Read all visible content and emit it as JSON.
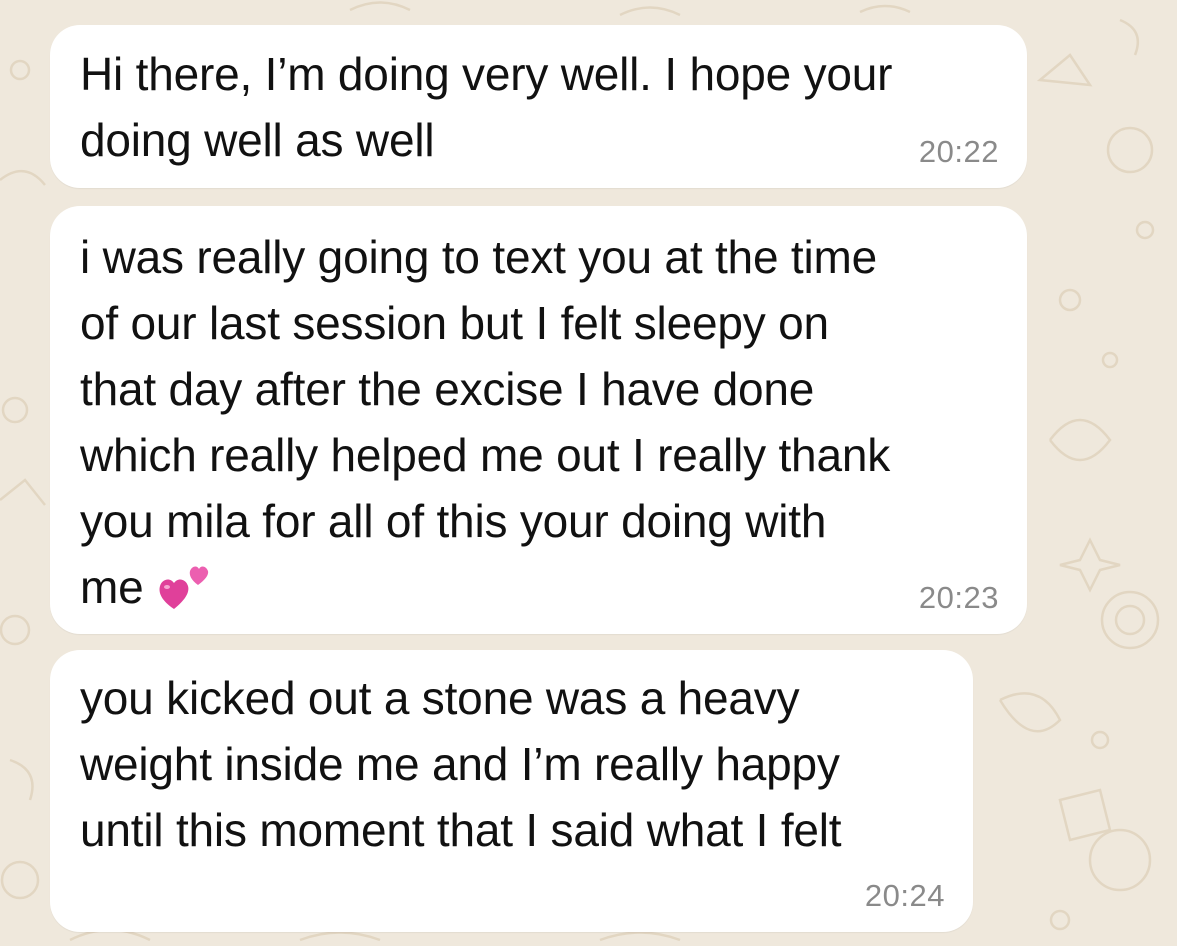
{
  "messages": [
    {
      "text": "Hi there, I’m doing very well. I hope your\ndoing well as well",
      "time": "20:22"
    },
    {
      "text": "i was really going to text you at the time\nof our last session but I felt sleepy on\nthat day after the excise I have done\nwhich really helped me out I really thank\nyou mila for all of this your doing with\nme",
      "emoji": "two-hearts-icon",
      "time": "20:23"
    },
    {
      "text": "you kicked out a stone was a heavy\nweight inside me and I’m really happy\nuntil this moment that I said what I felt",
      "time": "20:24"
    }
  ],
  "colors": {
    "wallpaper": "#efe8dc",
    "bubble": "#ffffff",
    "text": "#111111",
    "timestamp": "#8a8a8a",
    "heart": "#e0409a"
  }
}
